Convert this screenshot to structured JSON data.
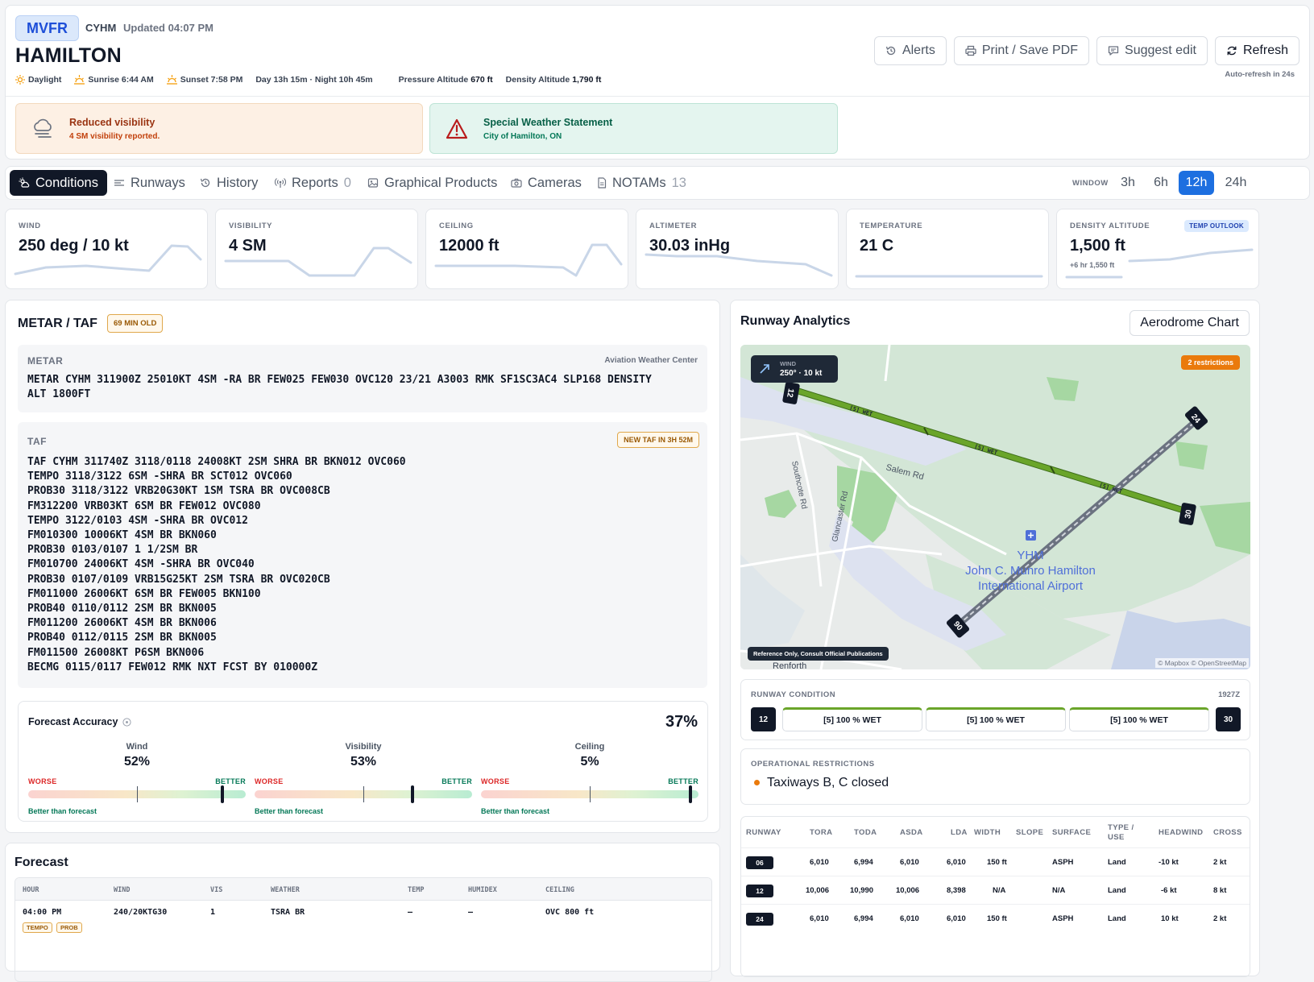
{
  "header": {
    "flight_category": "MVFR",
    "icao": "CYHM",
    "updated": "Updated 04:07 PM",
    "city": "HAMILTON",
    "daylight": "Daylight",
    "sunrise": "Sunrise 6:44 AM",
    "sunset": "Sunset 7:58 PM",
    "day_night": "Day 13h 15m · Night 10h 45m",
    "pressure_alt_label": "Pressure Altitude",
    "pressure_alt_value": "670 ft",
    "density_alt_label": "Density Altitude",
    "density_alt_value": "1,790 ft",
    "buttons": {
      "alerts": "Alerts",
      "print": "Print / Save PDF",
      "suggest": "Suggest edit",
      "refresh": "Refresh"
    },
    "auto_refresh": "Auto-refresh in 24s"
  },
  "alerts": [
    {
      "title": "Reduced visibility",
      "subtitle": "4 SM visibility reported.",
      "color": "#9a3412"
    },
    {
      "title": "Special Weather Statement",
      "subtitle": "City of Hamilton, ON",
      "color": "#047857"
    }
  ],
  "tabs": [
    {
      "label": "Conditions",
      "icon": "sun-cloud-icon"
    },
    {
      "label": "Runways",
      "icon": "runway-icon"
    },
    {
      "label": "History",
      "icon": "history-icon"
    },
    {
      "label": "Reports",
      "count": "0",
      "icon": "radio-icon"
    },
    {
      "label": "Graphical Products",
      "icon": "image-icon"
    },
    {
      "label": "Cameras",
      "icon": "camera-icon"
    },
    {
      "label": "NOTAMs",
      "count": "13",
      "icon": "document-icon"
    }
  ],
  "window": {
    "label": "WINDOW",
    "options": [
      "3h",
      "6h",
      "12h",
      "24h"
    ],
    "selected": "12h"
  },
  "metrics": [
    {
      "label": "WIND",
      "value": "250 deg / 10 kt"
    },
    {
      "label": "VISIBILITY",
      "value": "4 SM"
    },
    {
      "label": "CEILING",
      "value": "12000 ft"
    },
    {
      "label": "ALTIMETER",
      "value": "30.03 inHg"
    },
    {
      "label": "TEMPERATURE",
      "value": "21 C"
    },
    {
      "label": "DENSITY ALTITUDE",
      "value": "1,500 ft",
      "tag": "TEMP OUTLOOK",
      "sub": "+6 hr 1,550 ft"
    }
  ],
  "metar_taf": {
    "title": "METAR / TAF",
    "age_badge": "69 MIN OLD",
    "metar_label": "METAR",
    "metar_source": "Aviation Weather Center",
    "metar_text": "METAR CYHM 311900Z 25010KT 4SM -RA BR FEW025 FEW030 OVC120 23/21 A3003 RMK SF1SC3AC4 SLP168 DENSITY\nALT 1800FT",
    "taf_label": "TAF",
    "taf_badge": "NEW TAF IN 3H 52M",
    "taf_text": "TAF CYHM 311740Z 3118/0118 24008KT 2SM SHRA BR BKN012 OVC060\nTEMPO 3118/3122 6SM -SHRA BR SCT012 OVC060\nPROB30 3118/3122 VRB20G30KT 1SM TSRA BR OVC008CB\nFM312200 VRB03KT 6SM BR FEW012 OVC080\nTEMPO 3122/0103 4SM -SHRA BR OVC012\nFM010300 10006KT 4SM BR BKN060\nPROB30 0103/0107 1 1/2SM BR\nFM010700 24006KT 4SM -SHRA BR OVC040\nPROB30 0107/0109 VRB15G25KT 2SM TSRA BR OVC020CB\nFM011000 26006KT 6SM BR FEW005 BKN100\nPROB40 0110/0112 2SM BR BKN005\nFM011200 26006KT 4SM BR BKN006\nPROB40 0112/0115 2SM BR BKN005\nFM011500 26008KT P6SM BKN006\nBECMG 0115/0117 FEW012 RMK NXT FCST BY 010000Z"
  },
  "forecast_accuracy": {
    "title": "Forecast Accuracy",
    "overall": "37%",
    "worse_label": "WORSE",
    "better_label": "BETTER",
    "items": [
      {
        "label": "Wind",
        "value": "52%",
        "position": 0.9,
        "note": "Better than forecast"
      },
      {
        "label": "Visibility",
        "value": "53%",
        "position": 0.73,
        "note": "Better than forecast"
      },
      {
        "label": "Ceiling",
        "value": "5%",
        "position": 0.97,
        "note": "Better than forecast"
      }
    ]
  },
  "forecast": {
    "title": "Forecast",
    "columns": [
      "HOUR",
      "WIND",
      "VIS",
      "WEATHER",
      "TEMP",
      "HUMIDEX",
      "CEILING"
    ],
    "rows": [
      {
        "hour": "04:00 PM",
        "wind": "240/20KTG30",
        "vis": "1",
        "weather": "TSRA BR",
        "temp": "–",
        "humidex": "–",
        "ceiling": "OVC 800 ft",
        "tags": [
          "TEMPO",
          "PROB"
        ]
      }
    ]
  },
  "runway_analytics": {
    "title": "Runway Analytics",
    "chart_button": "Aerodrome Chart",
    "map": {
      "wind_label": "WIND",
      "wind_value": "250° · 10 kt",
      "restrictions_badge": "2 restrictions",
      "reference_note": "Reference Only, Consult Official Publications",
      "credit": "© Mapbox © OpenStreetMap",
      "airport_code": "YHM",
      "airport_name_1": "John C. Munro Hamilton",
      "airport_name_2": "International Airport",
      "roads": [
        "Salem Rd",
        "Southcote Rd",
        "Glancaster Rd",
        "Renforth"
      ],
      "runway_ends": [
        "12",
        "30",
        "24",
        "06"
      ],
      "segment_label": "[5] WET"
    },
    "condition": {
      "label": "RUNWAY CONDITION",
      "time": "1927Z",
      "start": "12",
      "end": "30",
      "segments": [
        "[5] 100 % WET",
        "[5] 100 % WET",
        "[5] 100 % WET"
      ]
    },
    "restrictions": {
      "label": "OPERATIONAL RESTRICTIONS",
      "items": [
        "Taxiways B, C closed"
      ]
    },
    "table": {
      "columns": [
        "RUNWAY",
        "TORA",
        "TODA",
        "ASDA",
        "LDA",
        "WIDTH",
        "SLOPE",
        "SURFACE",
        "TYPE / USE",
        "HEADWIND",
        "CROSS"
      ],
      "rows": [
        [
          "06",
          "6,010",
          "6,994",
          "6,010",
          "6,010",
          "150 ft",
          "",
          "ASPH",
          "Land",
          "-10 kt",
          "2 kt"
        ],
        [
          "12",
          "10,006",
          "10,990",
          "10,006",
          "8,398",
          "N/A",
          "",
          "N/A",
          "Land",
          "-6 kt",
          "8 kt"
        ],
        [
          "24",
          "6,010",
          "6,994",
          "6,010",
          "6,010",
          "150 ft",
          "",
          "ASPH",
          "Land",
          "10 kt",
          "2 kt"
        ]
      ]
    }
  }
}
